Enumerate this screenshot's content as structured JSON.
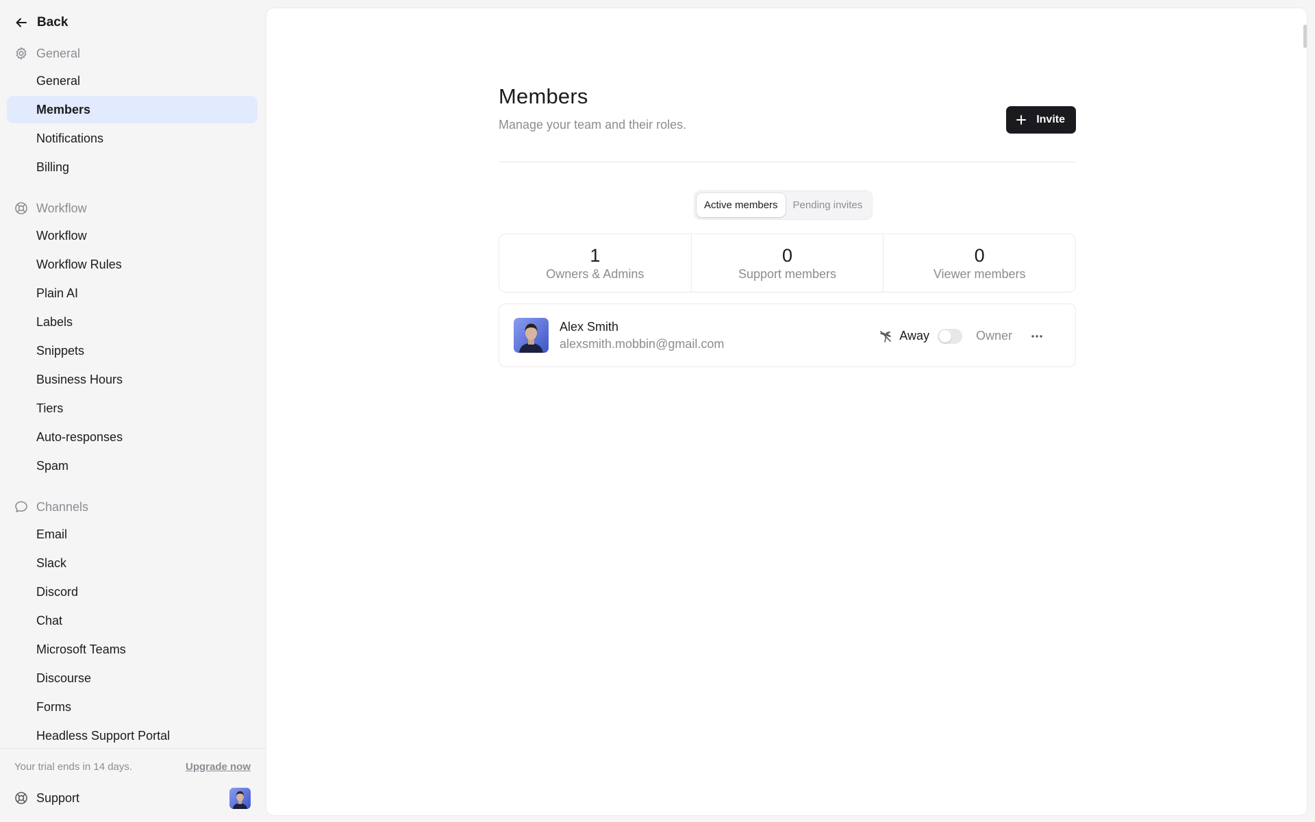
{
  "sidebar": {
    "back_label": "Back",
    "groups": [
      {
        "title": "General",
        "icon": "gear-icon",
        "items": [
          "General",
          "Members",
          "Notifications",
          "Billing"
        ]
      },
      {
        "title": "Workflow",
        "icon": "lifebuoy-icon",
        "items": [
          "Workflow",
          "Workflow Rules",
          "Plain AI",
          "Labels",
          "Snippets",
          "Business Hours",
          "Tiers",
          "Auto-responses",
          "Spam"
        ]
      },
      {
        "title": "Channels",
        "icon": "chat-bubble-icon",
        "items": [
          "Email",
          "Slack",
          "Discord",
          "Chat",
          "Microsoft Teams",
          "Discourse",
          "Forms",
          "Headless Support Portal"
        ]
      }
    ],
    "active_item": "Members",
    "trial_text": "Your trial ends in 14 days.",
    "upgrade_label": "Upgrade now",
    "support_label": "Support"
  },
  "page": {
    "title": "Members",
    "subtitle": "Manage your team and their roles.",
    "invite_label": "Invite"
  },
  "tabs": [
    {
      "label": "Active members",
      "active": true
    },
    {
      "label": "Pending invites",
      "active": false
    }
  ],
  "stats": [
    {
      "value": "1",
      "label": "Owners & Admins"
    },
    {
      "value": "0",
      "label": "Support members"
    },
    {
      "value": "0",
      "label": "Viewer members"
    }
  ],
  "members": [
    {
      "name": "Alex Smith",
      "email": "alexsmith.mobbin@gmail.com",
      "away_label": "Away",
      "away_on": false,
      "role": "Owner"
    }
  ],
  "colors": {
    "accent_active_bg": "#e2eafd",
    "primary_button": "#1b1b1f",
    "muted_text": "#8c8c93"
  }
}
